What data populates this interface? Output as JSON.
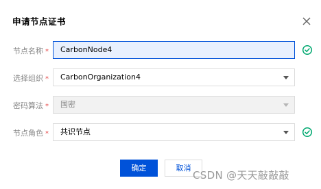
{
  "dialog": {
    "title": "申请节点证书",
    "close_icon": "close-icon"
  },
  "form": {
    "required_mark": "*",
    "node_name": {
      "label": "节点名称",
      "value": "CarbonNode4",
      "status_icon": "check-circle-icon"
    },
    "organization": {
      "label": "选择组织",
      "value": "CarbonOrganization4",
      "dropdown_icon": "caret-down-icon"
    },
    "crypto_algorithm": {
      "label": "密码算法",
      "value": "国密",
      "disabled": true,
      "dropdown_icon": "caret-down-icon"
    },
    "node_role": {
      "label": "节点角色",
      "value": "共识节点",
      "dropdown_icon": "caret-down-icon",
      "status_icon": "check-circle-icon"
    }
  },
  "buttons": {
    "confirm_label": "确定",
    "cancel_label": "取消"
  },
  "watermark": "CSDN @天天敲敲敲",
  "colors": {
    "primary": "#0052d9",
    "success": "#00a870",
    "required": "#e54545",
    "focused_bg": "#e8f0fe",
    "disabled_bg": "#f2f2f2"
  }
}
